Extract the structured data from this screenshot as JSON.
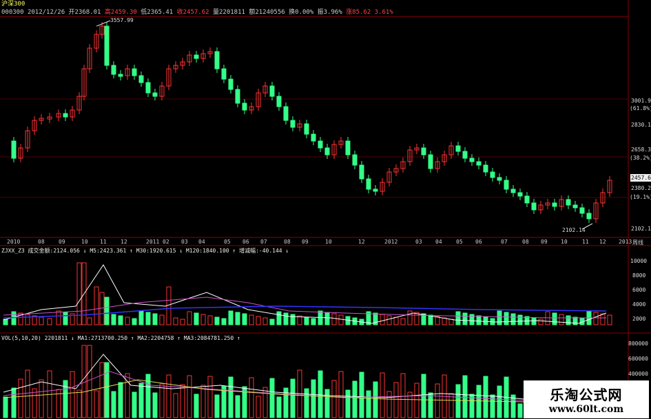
{
  "header": {
    "title": "沪深300",
    "line1": {
      "code": "000300",
      "date": "2012/12/26",
      "open": "开2368.01",
      "high": "高2459.30",
      "low": "低2365.41",
      "close": "收2457.62",
      "volume": "量2201811",
      "amount": "额21240556",
      "turnover": "换0.00%",
      "amplitude": "振3.96%",
      "change": "涨85.62",
      "change_pct": "3.61%"
    }
  },
  "price_panel": {
    "peak_label": "3557.99",
    "trough_label": "2102.14",
    "right_axis": [
      "3001.9",
      "(61.8%)",
      "2830.1",
      "2658.3",
      "(38.2%)",
      "2457.6",
      "2380.2",
      "(19.1%)",
      "2102.1"
    ],
    "x_axis": [
      "2010",
      "08",
      "09",
      "10",
      "11",
      "12",
      "2011",
      "02",
      "03",
      "04",
      "05",
      "06",
      "07",
      "08",
      "09",
      "10",
      "12",
      "2012",
      "03",
      "04",
      "05",
      "06",
      "07",
      "08",
      "09",
      "10",
      "11",
      "12",
      "2013",
      "周线"
    ]
  },
  "indicator_panel": {
    "legend": "ZJXX_Z3  成交金额:2124.056 ↓ M5:2423.361 ↑ M30:1920.615 ↓ M120:1840.100 ↑ 增减幅:-40.144 ↓",
    "right_axis": [
      "10000",
      "8000",
      "6000",
      "4000",
      "2000"
    ]
  },
  "volume_panel": {
    "legend": "VOL(5,10,20)  2201811 ↓ MA1:2713700.250 ↑ MA2:2204758 ↑ MA3:2084781.250 ↑",
    "right_axis": [
      "800000",
      "600000",
      "400000"
    ]
  },
  "watermark": {
    "title": "乐淘公式网",
    "url": "www.60lt.com"
  },
  "colors": {
    "up": "#ff3333",
    "down": "#33ff88",
    "ma_white": "#ffffff",
    "ma_purple": "#cc55cc",
    "ma_blue": "#3333ff",
    "ma_yellow": "#dddd55",
    "grid": "#8b0000"
  }
}
